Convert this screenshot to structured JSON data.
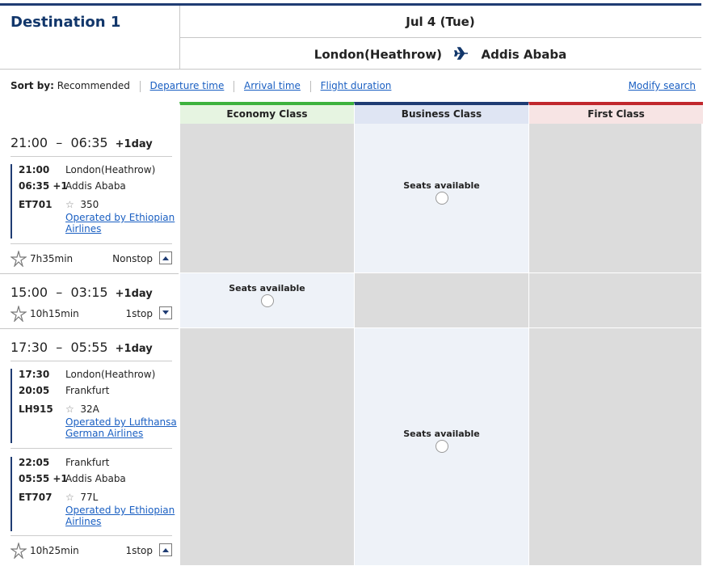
{
  "header": {
    "destination": "Destination 1",
    "date": "Jul 4 (Tue)",
    "from": "London(Heathrow)",
    "to": "Addis Ababa"
  },
  "sort": {
    "label": "Sort by:",
    "current": "Recommended",
    "departure": "Departure time",
    "arrival": "Arrival time",
    "duration": "Flight duration",
    "modify": "Modify search"
  },
  "classes": {
    "economy": "Economy Class",
    "business": "Business Class",
    "first": "First Class"
  },
  "seats_label": "Seats available",
  "colors": {
    "economy": "#3db23d",
    "business": "#1f3c73",
    "first": "#c1272d",
    "brand": "#12376b"
  },
  "flights": [
    {
      "dep": "21:00",
      "arr": "06:35",
      "plus": "+1day",
      "segments": [
        {
          "dep_time": "21:00",
          "dep_city": "London(Heathrow)",
          "arr_time": "06:35 +1",
          "arr_city": "Addis Ababa",
          "flight_no": "ET701",
          "aircraft": "350",
          "operated_1": "Operated by Ethiopian",
          "operated_2": "Airlines"
        }
      ],
      "duration": "7h35min",
      "stops": "Nonstop",
      "availability": {
        "economy": "",
        "business": "Seats available",
        "first": ""
      }
    },
    {
      "dep": "15:00",
      "arr": "03:15",
      "plus": "+1day",
      "duration": "10h15min",
      "stops": "1stop",
      "availability": {
        "economy": "Seats available",
        "business": "",
        "first": ""
      }
    },
    {
      "dep": "17:30",
      "arr": "05:55",
      "plus": "+1day",
      "segments": [
        {
          "dep_time": "17:30",
          "dep_city": "London(Heathrow)",
          "arr_time": "20:05",
          "arr_city": "Frankfurt",
          "flight_no": "LH915",
          "aircraft": "32A",
          "operated_1": "Operated by Lufthansa",
          "operated_2": "German Airlines"
        },
        {
          "dep_time": "22:05",
          "dep_city": "Frankfurt",
          "arr_time": "05:55 +1",
          "arr_city": "Addis Ababa",
          "flight_no": "ET707",
          "aircraft": "77L",
          "operated_1": "Operated by Ethiopian",
          "operated_2": "Airlines"
        }
      ],
      "duration": "10h25min",
      "stops": "1stop",
      "availability": {
        "economy": "",
        "business": "Seats available",
        "first": ""
      }
    }
  ]
}
